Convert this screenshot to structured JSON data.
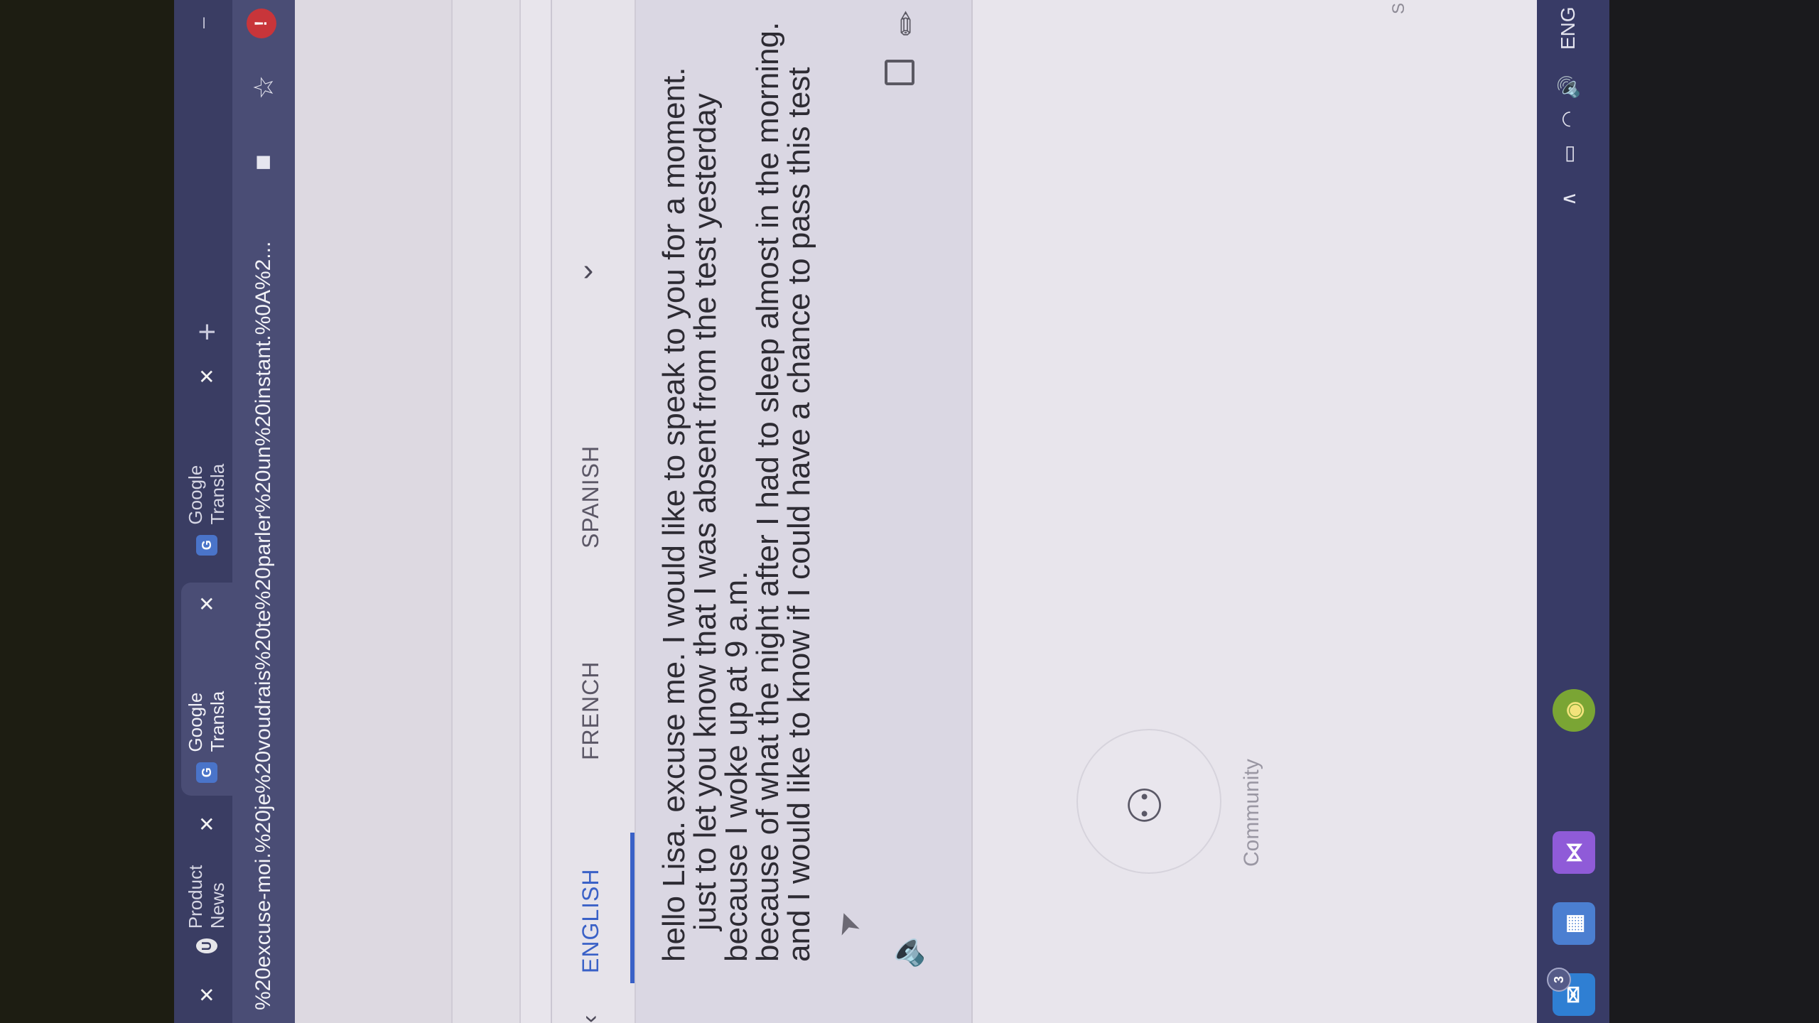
{
  "browser": {
    "tabs": [
      {
        "label": "",
        "active": false
      },
      {
        "label": "Product News",
        "active": false
      },
      {
        "label": "Google Transla",
        "active": true
      },
      {
        "label": "Google Transla",
        "active": false
      }
    ],
    "url": "%20excuse-moi.%20je%20voudrais%20te%20parler%20un%20instant.%0A%2...",
    "ext_badge": "!"
  },
  "translator": {
    "languages": [
      "ENGLISH",
      "FRENCH",
      "SPANISH"
    ],
    "active_language": "ENGLISH",
    "output_lines": [
      "hello Lisa. excuse me. I would like to speak to you for a moment.",
      "just to let you know that I was absent from the test yesterday",
      "because I woke up at 9 a.m.",
      "because of what the night after I had to sleep almost in the morning.",
      "and I would like to know if I could have a chance to pass this test"
    ]
  },
  "community": {
    "label": "Community"
  },
  "page_fragment": "S",
  "taskbar": {
    "mail_badge": "3",
    "language": "ENG"
  }
}
